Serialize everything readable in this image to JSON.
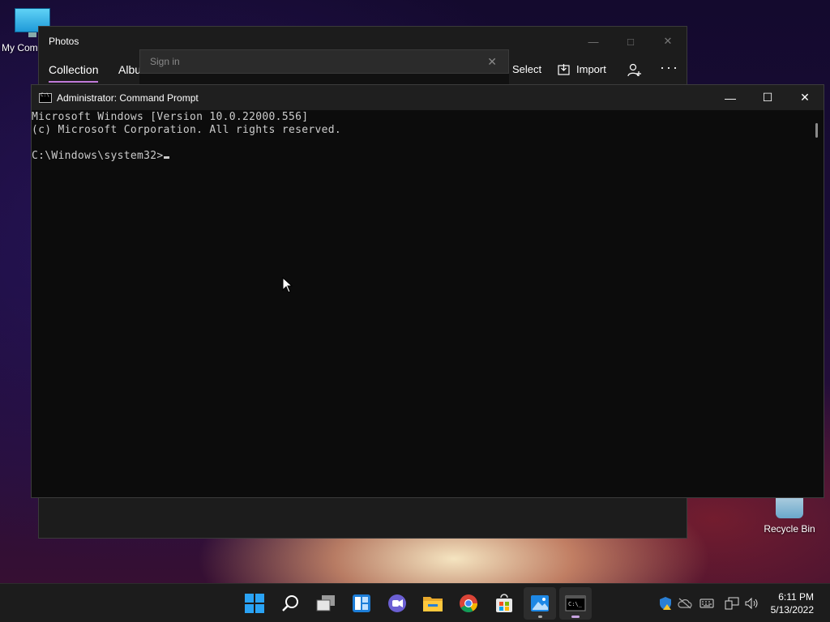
{
  "desktop": {
    "my_computer_label": "My Com",
    "recycle_bin_label": "Recycle Bin"
  },
  "photos": {
    "title": "Photos",
    "tabs": [
      {
        "label": "Collection",
        "active": true
      },
      {
        "label": "Albu",
        "active": false
      }
    ],
    "toolbar": {
      "select_label": "Select",
      "import_label": "Import"
    },
    "signin": {
      "placeholder": "Sign in"
    }
  },
  "cmd": {
    "title": "Administrator: Command Prompt",
    "lines": [
      "Microsoft Windows [Version 10.0.22000.556]",
      "(c) Microsoft Corporation. All rights reserved.",
      "",
      "C:\\Windows\\system32>"
    ]
  },
  "taskbar": {
    "time": "6:11 PM",
    "date": "5/13/2022",
    "apps": [
      "start-icon",
      "search-icon",
      "task-view-icon",
      "widgets-icon",
      "teams-chat-icon",
      "file-explorer-icon",
      "chrome-icon",
      "store-icon",
      "photos-icon",
      "terminal-icon"
    ]
  },
  "colors": {
    "accent": "#c07ad8",
    "console_bg": "#0c0c0c",
    "console_fg": "#cccccc",
    "taskbar_bg": "#1c1c1c"
  }
}
